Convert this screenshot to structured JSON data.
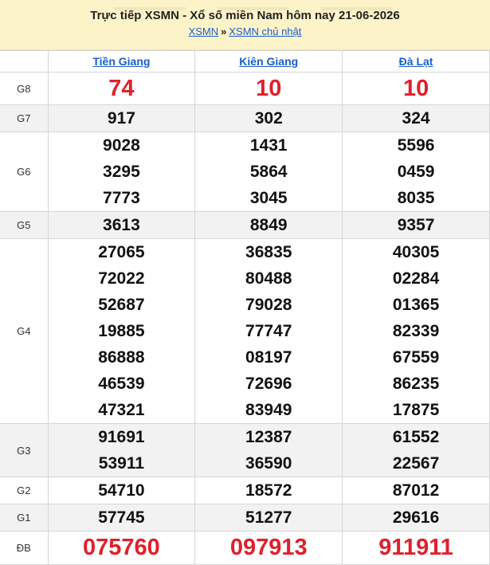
{
  "header": {
    "title": "Trực tiếp XSMN - Xổ số miền Nam hôm nay 21-06-2026",
    "breadcrumb": {
      "home": "XSMN",
      "separator": "»",
      "current": "XSMN chủ nhật"
    }
  },
  "provinces": [
    "Tiền Giang",
    "Kiên Giang",
    "Đà Lạt"
  ],
  "prizes": [
    {
      "label": "G8",
      "values": [
        [
          "74"
        ],
        [
          "10"
        ],
        [
          "10"
        ]
      ]
    },
    {
      "label": "G7",
      "values": [
        [
          "917"
        ],
        [
          "302"
        ],
        [
          "324"
        ]
      ]
    },
    {
      "label": "G6",
      "values": [
        [
          "9028",
          "3295",
          "7773"
        ],
        [
          "1431",
          "5864",
          "3045"
        ],
        [
          "5596",
          "0459",
          "8035"
        ]
      ]
    },
    {
      "label": "G5",
      "values": [
        [
          "3613"
        ],
        [
          "8849"
        ],
        [
          "9357"
        ]
      ]
    },
    {
      "label": "G4",
      "values": [
        [
          "27065",
          "72022",
          "52687",
          "19885",
          "86888",
          "46539",
          "47321"
        ],
        [
          "36835",
          "80488",
          "79028",
          "77747",
          "08197",
          "72696",
          "83949"
        ],
        [
          "40305",
          "02284",
          "01365",
          "82339",
          "67559",
          "86235",
          "17875"
        ]
      ]
    },
    {
      "label": "G3",
      "values": [
        [
          "91691",
          "53911"
        ],
        [
          "12387",
          "36590"
        ],
        [
          "61552",
          "22567"
        ]
      ]
    },
    {
      "label": "G2",
      "values": [
        [
          "54710"
        ],
        [
          "18572"
        ],
        [
          "87012"
        ]
      ]
    },
    {
      "label": "G1",
      "values": [
        [
          "57745"
        ],
        [
          "51277"
        ],
        [
          "29616"
        ]
      ]
    },
    {
      "label": "ĐB",
      "values": [
        [
          "075760"
        ],
        [
          "097913"
        ],
        [
          "911911"
        ]
      ]
    }
  ],
  "colors": {
    "header_bg": "#fdf3c9",
    "link": "#1a5fc8",
    "highlight": "#e0202b"
  }
}
